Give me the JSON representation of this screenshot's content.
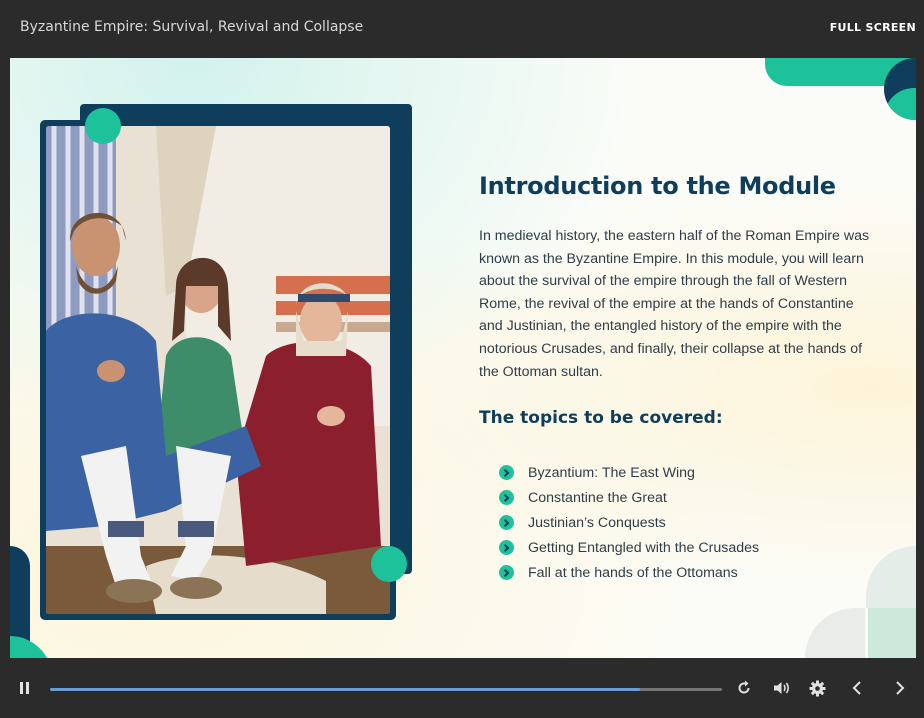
{
  "header": {
    "course_title": "Byzantine Empire: Survival, Revival and Collapse",
    "fullscreen_label": "FULL SCREEN"
  },
  "slide": {
    "heading": "Introduction to the Module",
    "intro": "In medieval history, the eastern half of the Roman Empire was known as the Byzantine Empire. In this module, you will learn about the survival of the empire through the fall of Western Rome, the revival of the empire at the hands of Constantine and Justinian, the entangled history of the empire with the notorious Crusades, and finally, their collapse at the hands of the Ottoman sultan.",
    "topics_heading": "The topics to be covered:",
    "topics": [
      "Byzantium: The East Wing",
      "Constantine the Great",
      "Justinian’s Conquests",
      "Getting Entangled with the Crusades",
      "Fall at the hands of the Ottomans"
    ],
    "photo": "three people in medieval costume seated in a tent"
  },
  "player": {
    "progress": 0.878,
    "icons": [
      "pause-icon",
      "replay-icon",
      "volume-icon",
      "settings-icon",
      "prev-icon",
      "next-icon"
    ]
  },
  "colors": {
    "accent": "#1ec29a",
    "navy": "#0f3d5c",
    "progress": "#6d9bd3"
  }
}
